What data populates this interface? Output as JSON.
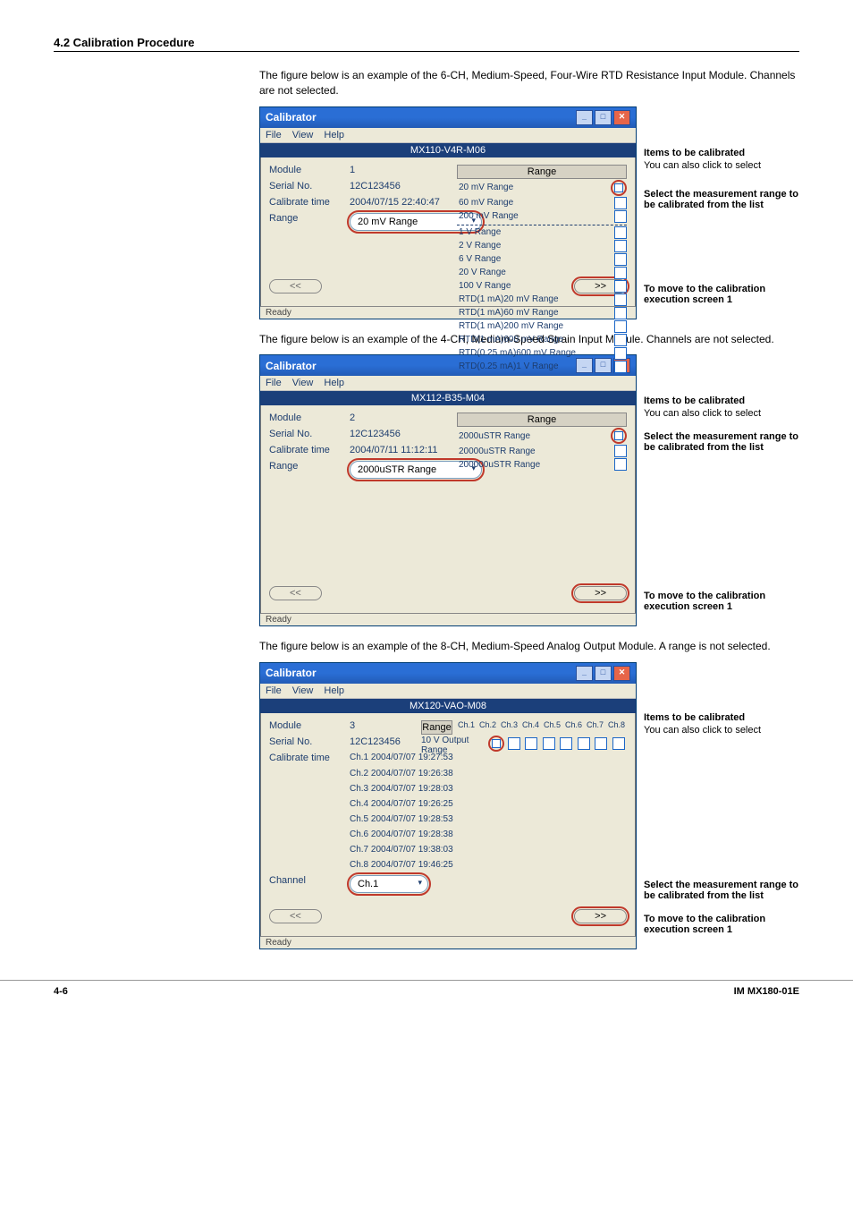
{
  "section_heading": "4.2  Calibration Procedure",
  "fig1_intro": "The figure below is an example of the 6-CH, Medium-Speed, Four-Wire RTD Resistance Input Module. Channels are not selected.",
  "fig2_intro": "The figure below is an example of the 4-CH, Medium-Speed Strain Input Module. Channels are not selected.",
  "fig3_intro": "The figure below is an example of the 8-CH, Medium-Speed Analog Output Module. A range is not selected.",
  "window_title": "Calibrator",
  "menus": [
    "File",
    "View",
    "Help"
  ],
  "statusbar": "Ready",
  "nav_prev": "<<",
  "nav_next": ">>",
  "range_header": "Range",
  "labels": {
    "module": "Module",
    "serial": "Serial No.",
    "caltime": "Calibrate time",
    "range": "Range",
    "channel": "Channel"
  },
  "fig1": {
    "banner": "MX110-V4R-M06",
    "module": "1",
    "serial": "12C123456",
    "caltime": "2004/07/15 22:40:47",
    "range_sel": "20 mV Range",
    "ranges": [
      "20 mV Range",
      "60 mV Range",
      "200 mV Range",
      "1 V Range",
      "2 V Range",
      "6 V Range",
      "20 V Range",
      "100 V Range",
      "RTD(1 mA)20 mV Range",
      "RTD(1 mA)60 mV Range",
      "RTD(1 mA)200 mV Range",
      "RTD(1 mA)600 mV Range",
      "RTD(0.25 mA)600 mV Range",
      "RTD(0.25 mA)1 V Range"
    ]
  },
  "fig2": {
    "banner": "MX112-B35-M04",
    "module": "2",
    "serial": "12C123456",
    "caltime": "2004/07/11 11:12:11",
    "range_sel": "2000uSTR Range",
    "ranges": [
      "2000uSTR Range",
      "20000uSTR Range",
      "200000uSTR Range"
    ]
  },
  "fig3": {
    "banner": "MX120-VAO-M08",
    "module": "3",
    "serial": "12C123456",
    "caltimes": [
      "Ch.1  2004/07/07 19:27:53",
      "Ch.2  2004/07/07 19:26:38",
      "Ch.3  2004/07/07 19:28:03",
      "Ch.4  2004/07/07 19:26:25",
      "Ch.5  2004/07/07 19:28:53",
      "Ch.6  2004/07/07 19:28:38",
      "Ch.7  2004/07/07 19:38:03",
      "Ch.8  2004/07/07 19:46:25"
    ],
    "channel_sel": "Ch.1",
    "ch_headers": [
      "Ch.1",
      "Ch.2",
      "Ch.3",
      "Ch.4",
      "Ch.5",
      "Ch.6",
      "Ch.7",
      "Ch.8"
    ],
    "output_row_label": "10 V Output Range"
  },
  "annot": {
    "items_head": "Items to be calibrated",
    "items_sub": "You can also click to select",
    "select_head": "Select the measurement range to be calibrated from the list",
    "move_head": "To move to the calibration execution screen 1"
  },
  "footer_left": "4-6",
  "footer_right": "IM MX180-01E"
}
